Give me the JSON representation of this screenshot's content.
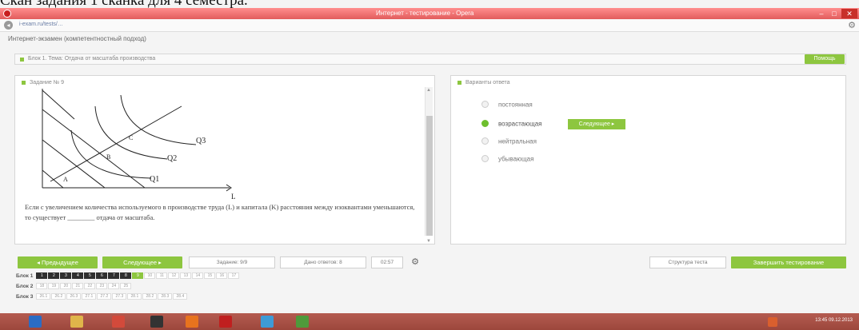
{
  "caption": "Скан задания 1 сканка для 4 семестра.",
  "window": {
    "title": "Интернет - тестирование - Opera"
  },
  "address": {
    "url": "i-exam.ru/tests/…"
  },
  "header": {
    "subtitle": "Интернет-экзамен (компетентностный подход)"
  },
  "block": {
    "label": "Блок 1. Тема: Отдача от масштаба производства",
    "help_label": "Помощь"
  },
  "task": {
    "title": "Задание № 9",
    "graph": {
      "q_labels": [
        "Q1",
        "Q2",
        "Q3"
      ],
      "points": [
        "A",
        "B",
        "C"
      ],
      "axis_label": "L"
    },
    "question": "Если с увеличением количества используемого в производстве труда (L) и капитала (K) расстояния между изоквантами уменьшаются, то существует ________ отдача от масштаба."
  },
  "answers": {
    "title": "Варианты ответа",
    "options": [
      {
        "label": "постоянная",
        "selected": false
      },
      {
        "label": "возрастающая",
        "selected": true
      },
      {
        "label": "нейтральная",
        "selected": false
      },
      {
        "label": "убывающая",
        "selected": false
      }
    ],
    "next_inline_label": "Следующее"
  },
  "nav": {
    "prev_label": "Предыдущее",
    "next_label": "Следующее",
    "task_counter": "Задание: 9/9",
    "remaining": "Дано ответов: 8",
    "timer": "02:57",
    "structure_label": "Структура теста",
    "finish_label": "Завершить тестирование"
  },
  "blocks": [
    {
      "label": "Блок 1",
      "cells": [
        "1",
        "2",
        "3",
        "4",
        "5",
        "6",
        "7",
        "8",
        "9",
        "10",
        "11",
        "12",
        "13",
        "14",
        "15",
        "16",
        "17"
      ],
      "done": 8,
      "current": 8
    },
    {
      "label": "Блок 2",
      "cells": [
        "18",
        "19",
        "20",
        "21",
        "22",
        "23",
        "24",
        "25"
      ],
      "done": 0,
      "current": -1
    },
    {
      "label": "Блок 3",
      "cells": [
        "26.1",
        "26.2",
        "26.3",
        "27.1",
        "27.2",
        "27.3",
        "28.1",
        "28.2",
        "28.3",
        "28.4"
      ],
      "done": 0,
      "current": -1
    }
  ],
  "taskbar": {
    "clock": "13:45",
    "date": "09.12.2013"
  },
  "colors": {
    "accent": "#8dc63f",
    "titlebar": "#e25c5c",
    "taskbar": "#a24c40"
  }
}
